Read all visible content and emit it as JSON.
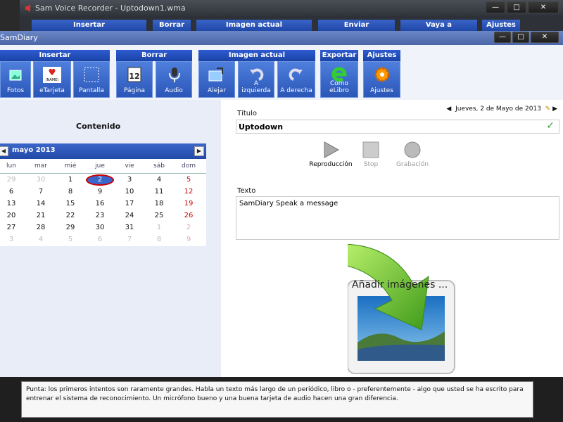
{
  "outer_window": {
    "title": "Sam Voice Recorder - Uptodown1.wma",
    "tabs": [
      "Insertar",
      "Borrar",
      "Imagen actual",
      "Enviar",
      "Vaya a",
      "Ajustes"
    ]
  },
  "inner_window": {
    "title": "SamDiary"
  },
  "ribbon": {
    "groups": [
      {
        "title": "Insertar",
        "buttons": [
          "Fotos",
          "eTarjeta",
          "Pantalla"
        ]
      },
      {
        "title": "Borrar",
        "buttons": [
          "Página",
          "Audio"
        ]
      },
      {
        "title": "Imagen actual",
        "buttons": [
          "Alejar",
          "A izquierda",
          "A derecha"
        ]
      },
      {
        "title": "Exportar",
        "buttons": [
          "Como eLibro"
        ]
      },
      {
        "title": "Ajustes",
        "buttons": [
          "Ajustes"
        ]
      }
    ],
    "etarjeta_badge": "(NAME)"
  },
  "left": {
    "contents_title": "Contenido",
    "calendar": {
      "month": "mayo 2013",
      "weekdays": [
        "lun",
        "mar",
        "mié",
        "jue",
        "vie",
        "sáb",
        "dom"
      ],
      "rows": [
        [
          "29",
          "30",
          "1",
          "2",
          "3",
          "4",
          "5"
        ],
        [
          "6",
          "7",
          "8",
          "9",
          "10",
          "11",
          "12"
        ],
        [
          "13",
          "14",
          "15",
          "16",
          "17",
          "18",
          "19"
        ],
        [
          "20",
          "21",
          "22",
          "23",
          "24",
          "25",
          "26"
        ],
        [
          "27",
          "28",
          "29",
          "30",
          "31",
          "1",
          "2"
        ],
        [
          "3",
          "4",
          "5",
          "6",
          "7",
          "8",
          "9"
        ]
      ],
      "today": "2"
    }
  },
  "right": {
    "title_label": "Título",
    "date": "Jueves, 2 de Mayo de 2013",
    "title_value": "Uptodown",
    "player": {
      "play": "Reproducción",
      "stop": "Stop",
      "record": "Grabación"
    },
    "text_label": "Texto",
    "text_value": "SamDiary Speak a message",
    "add_images": "Añadir imágenes ..."
  },
  "tip": "Punta: los primeros intentos son raramente grandes. Habla un texto más largo de un periódico, libro o - preferentemente - algo que usted se ha escrito para entrenar el sistema de reconocimiento. Un micrófono bueno y una buena tarjeta de audio hacen una gran diferencia.",
  "colors": {
    "ribbon_blue": "#2a56b8",
    "accent_red": "#cc0000",
    "check_green": "#3a9a3a"
  }
}
